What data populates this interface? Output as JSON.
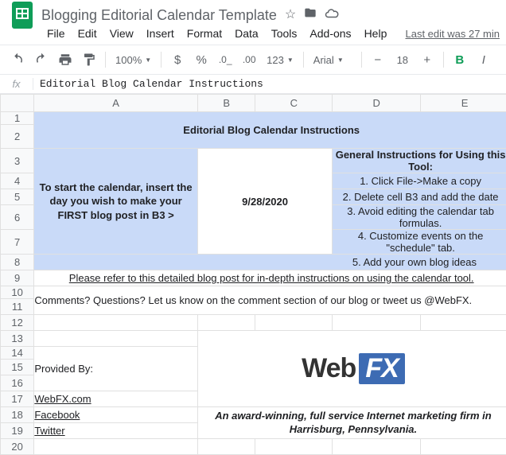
{
  "doc_title": "Blogging Editorial Calendar Template",
  "menus": [
    "File",
    "Edit",
    "View",
    "Insert",
    "Format",
    "Data",
    "Tools",
    "Add-ons",
    "Help"
  ],
  "last_edit": "Last edit was 27 min",
  "toolbar": {
    "zoom": "100%",
    "format_num": "123",
    "font": "Arial",
    "size": "18"
  },
  "formula_bar": {
    "label": "fx",
    "value": "Editorial Blog Calendar Instructions"
  },
  "columns": [
    "A",
    "B",
    "C",
    "D",
    "E"
  ],
  "rows": [
    "1",
    "2",
    "3",
    "4",
    "5",
    "6",
    "7",
    "8",
    "9",
    "10",
    "11",
    "12",
    "13",
    "14",
    "15",
    "16",
    "17",
    "18",
    "19",
    "20"
  ],
  "sheet": {
    "title": "Editorial Blog Calendar Instructions",
    "left_instruction": "To start the calendar, insert the day you wish to make your FIRST blog post in B3 >",
    "date": "9/28/2020",
    "instr_header": "General Instructions for Using this Tool:",
    "instr": [
      "1. Click File->Make a copy",
      "2. Delete cell B3 and add the date",
      "3. Avoid editing the calendar tab formulas.",
      "4. Customize events on the \"schedule\" tab.",
      "5. Add your own blog ideas"
    ],
    "detail_link": "Please refer to this detailed blog post for in-depth instructions on using the calendar tool.",
    "comments": "Comments? Questions? Let us know on the comment section of our blog or tweet us @WebFX.",
    "provided_by": "Provided By:",
    "links": [
      "WebFX.com",
      "Facebook",
      "Twitter"
    ],
    "logo_web": "Web",
    "logo_fx": "FX",
    "tagline": "An award-winning, full service Internet marketing firm in Harrisburg, Pennsylvania."
  }
}
